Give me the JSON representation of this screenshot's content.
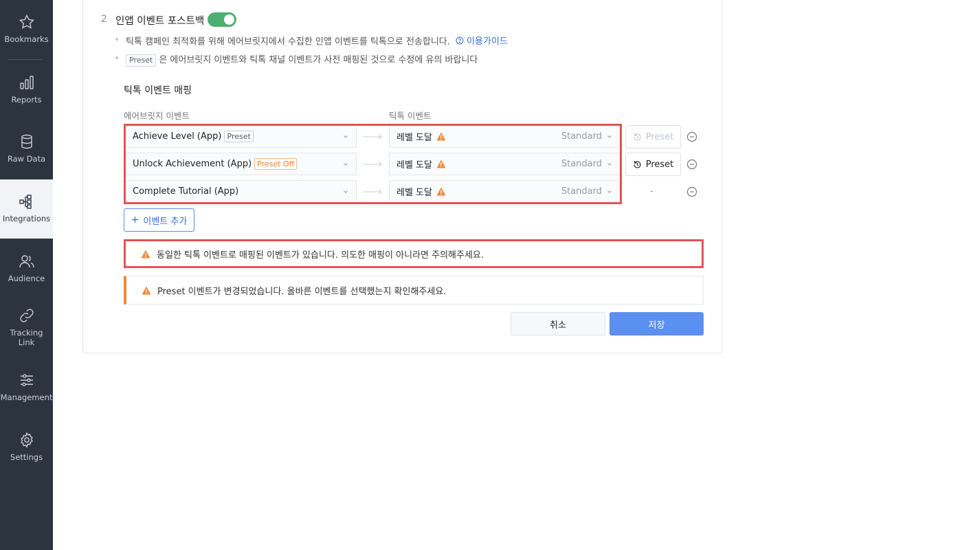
{
  "sidebar": {
    "items": [
      {
        "label": "Bookmarks",
        "icon": "star-icon"
      },
      {
        "label": "Reports",
        "icon": "bar-chart-icon"
      },
      {
        "label": "Raw Data",
        "icon": "database-icon"
      },
      {
        "label": "Integrations",
        "icon": "integrations-icon",
        "active": true
      },
      {
        "label": "Audience",
        "icon": "audience-icon"
      },
      {
        "label": "Tracking Link",
        "icon": "link-icon"
      },
      {
        "label": "Management",
        "icon": "sliders-icon"
      },
      {
        "label": "Settings",
        "icon": "gear-icon"
      }
    ]
  },
  "step": {
    "number": "2",
    "title": "인앱 이벤트 포스트백",
    "toggle_on": true
  },
  "descriptions": {
    "line1": "틱톡 캠페인 최적화를 위해 에어브릿지에서 수집한 인앱 이벤트를 틱톡으로 전송합니다.",
    "guide_link": "이용가이드",
    "preset_tag": "Preset",
    "line2": "은 에어브릿지 이벤트와 틱톡 채널 이벤트가 사전 매핑된 것으로 수정에 유의 바랍니다"
  },
  "mapping": {
    "title": "틱톡 이벤트 매핑",
    "col_airbridge": "에어브릿지 이벤트",
    "col_tiktok": "틱톡 이벤트",
    "rows": [
      {
        "source": "Achieve Level (App)",
        "tag": "Preset",
        "target": "레벨 도달",
        "target_type": "Standard",
        "action": "Preset",
        "action_state": "disabled"
      },
      {
        "source": "Unlock Achievement (App)",
        "tag": "Preset Off",
        "target": "레벨 도달",
        "target_type": "Standard",
        "action": "Preset",
        "action_state": "enabled"
      },
      {
        "source": "Complete Tutorial (App)",
        "tag": "",
        "target": "레벨 도달",
        "target_type": "Standard",
        "action": "-",
        "action_state": "none"
      }
    ],
    "add_button": "이벤트 추가"
  },
  "alerts": {
    "duplicate": "동일한 틱톡 이벤트로 매핑된 이벤트가 있습니다. 의도한 매핑이 아니라면 주의해주세요.",
    "preset_changed": "Preset 이벤트가 변경되었습니다. 올바른 이벤트를 선택했는지 확인해주세요."
  },
  "actions": {
    "cancel": "취소",
    "save": "저장"
  },
  "colors": {
    "sidebar_bg": "#2c3440",
    "toggle_on": "#4caf72",
    "warning": "#f08a3a",
    "error_outline": "#e05454",
    "primary": "#5b8ff0",
    "link": "#2f6fdc"
  }
}
